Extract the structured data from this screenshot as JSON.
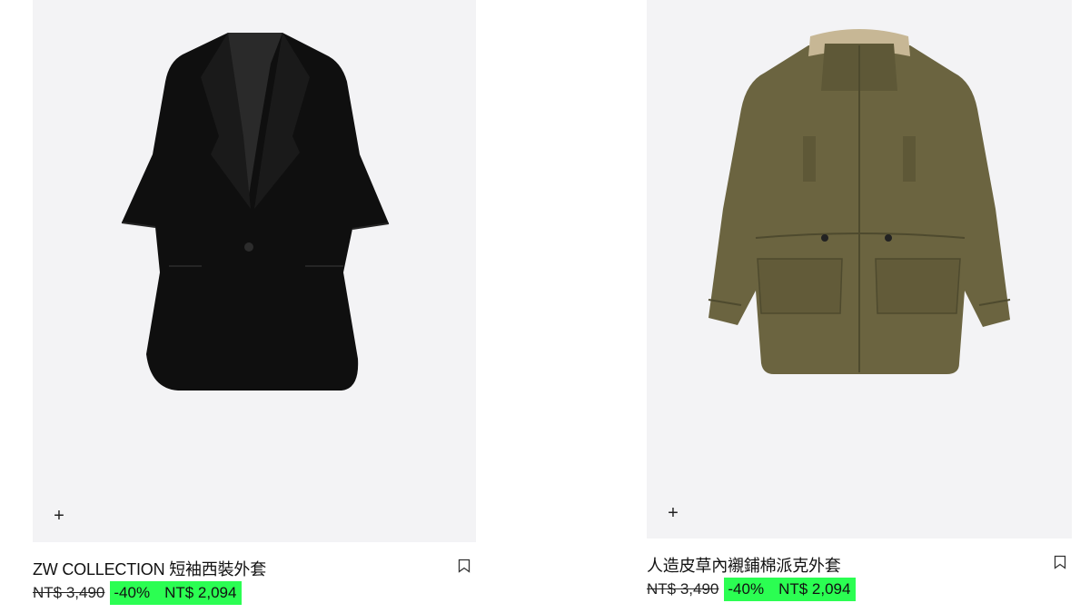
{
  "products": [
    {
      "name": "ZW COLLECTION 短袖西裝外套",
      "old_price": "NT$ 3,490",
      "discount": "-40%",
      "sale_price": "NT$ 2,094",
      "add_label": "+",
      "image": "black short-sleeve blazer",
      "color": "#0f0f0f"
    },
    {
      "name": "人造皮草內襯鋪棉派克外套",
      "old_price": "NT$ 3,490",
      "discount": "-40%",
      "sale_price": "NT$ 2,094",
      "add_label": "+",
      "image": "khaki parka with faux fur collar",
      "color": "#6b6440"
    }
  ],
  "colors": {
    "image_bg": "#f3f3f5",
    "sale_highlight": "#2bfe52"
  },
  "icons": [
    "plus-icon",
    "bookmark-icon"
  ]
}
